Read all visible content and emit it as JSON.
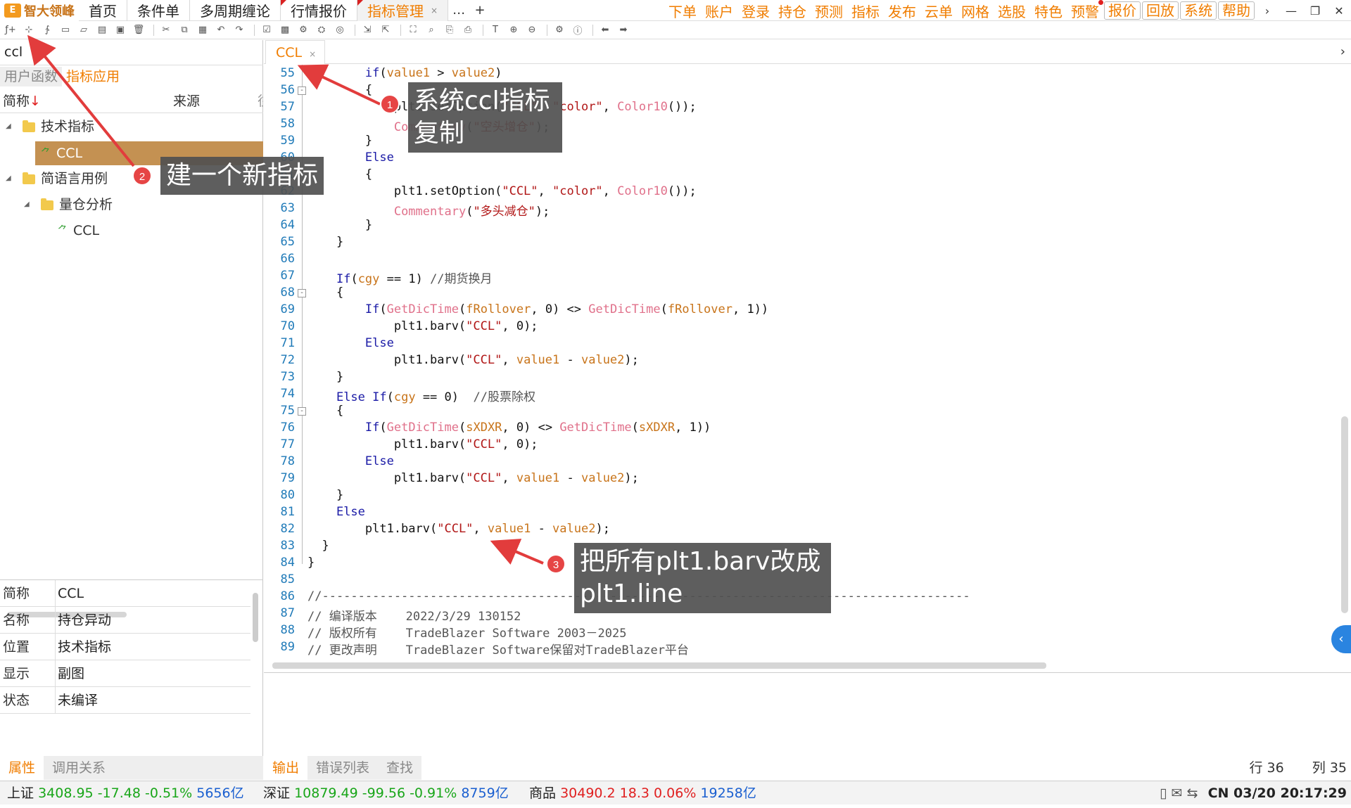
{
  "app": {
    "logo_text": "智大领峰",
    "logo_mark": "E"
  },
  "top_tabs": [
    {
      "label": "首页"
    },
    {
      "label": "条件单"
    },
    {
      "label": "多周期缠论"
    },
    {
      "label": "行情报价"
    },
    {
      "label": "指标管理",
      "close": "×"
    }
  ],
  "top_more": "…",
  "top_add": "+",
  "right_menu": [
    "下单",
    "账户",
    "登录",
    "持仓",
    "预测",
    "指标",
    "发布",
    "云单",
    "网格",
    "选股",
    "特色",
    "预警"
  ],
  "right_boxed": [
    "报价",
    "回放",
    "系统",
    "帮助"
  ],
  "window": {
    "chevron": "›",
    "minimize": "—",
    "restore": "❐",
    "close": "✕"
  },
  "search": {
    "value": "ccl"
  },
  "left_tabs": [
    {
      "label": "用户函数"
    },
    {
      "label": "指标应用"
    }
  ],
  "tree_header": {
    "name": "简称",
    "sort": "↓",
    "source": "来源",
    "extra": "往"
  },
  "tree": [
    {
      "label": "技术指标",
      "type": "folder",
      "expanded": true
    },
    {
      "label": "CCL",
      "type": "indicator",
      "selected": true
    },
    {
      "label": "简语言用例",
      "type": "folder",
      "expanded": true
    },
    {
      "label": "量仓分析",
      "type": "folder",
      "expanded": true
    },
    {
      "label": "CCL",
      "type": "indicator"
    }
  ],
  "properties": [
    {
      "key": "简称",
      "value": "CCL"
    },
    {
      "key": "名称",
      "value": "持仓异动"
    },
    {
      "key": "位置",
      "value": "技术指标"
    },
    {
      "key": "显示",
      "value": "副图"
    },
    {
      "key": "状态",
      "value": "未编译"
    }
  ],
  "left_bottom_tabs": [
    {
      "label": "属性"
    },
    {
      "label": "调用关系"
    }
  ],
  "editor": {
    "tab_label": "CCL",
    "tab_close": "×",
    "chevron": "›",
    "lines": [
      {
        "n": "55",
        "html": "        <span class='kw'>if</span>(<span class='var'>value1</span> &gt; <span class='var'>value2</span>)"
      },
      {
        "n": "56",
        "html": "        {",
        "fold": "-"
      },
      {
        "n": "57",
        "html": "            plt1.setOption(<span class='str'>\"CCL\"</span>, <span class='str'>\"color\"</span>, <span class='fn'>Color10</span>());"
      },
      {
        "n": "58",
        "html": "            <span class='fn'>Commentary</span>(<span class='str'>\"空头增仓\"</span>);"
      },
      {
        "n": "59",
        "html": "        }"
      },
      {
        "n": "60",
        "html": "        <span class='kw'>Else</span>"
      },
      {
        "n": "61",
        "html": "        {"
      },
      {
        "n": "62",
        "html": "            plt1.setOption(<span class='str'>\"CCL\"</span>, <span class='str'>\"color\"</span>, <span class='fn'>Color10</span>());"
      },
      {
        "n": "63",
        "html": "            <span class='fn'>Commentary</span>(<span class='str'>\"多头减仓\"</span>);"
      },
      {
        "n": "64",
        "html": "        }"
      },
      {
        "n": "65",
        "html": "    }"
      },
      {
        "n": "66",
        "html": ""
      },
      {
        "n": "67",
        "html": "    <span class='kw'>If</span>(<span class='var'>cgy</span> == 1) <span class='cm'>//期货换月</span>"
      },
      {
        "n": "68",
        "html": "    {",
        "fold": "-"
      },
      {
        "n": "69",
        "html": "        <span class='kw'>If</span>(<span class='fn'>GetDicTime</span>(<span class='var'>fRollover</span>, 0) &lt;&gt; <span class='fn'>GetDicTime</span>(<span class='var'>fRollover</span>, 1))"
      },
      {
        "n": "70",
        "html": "            plt1.barv(<span class='str'>\"CCL\"</span>, 0);"
      },
      {
        "n": "71",
        "html": "        <span class='kw'>Else</span>"
      },
      {
        "n": "72",
        "html": "            plt1.barv(<span class='str'>\"CCL\"</span>, <span class='var'>value1</span> - <span class='var'>value2</span>);"
      },
      {
        "n": "73",
        "html": "    }"
      },
      {
        "n": "74",
        "html": "    <span class='kw'>Else If</span>(<span class='var'>cgy</span> == 0)  <span class='cm'>//股票除权</span>"
      },
      {
        "n": "75",
        "html": "    {",
        "fold": "-"
      },
      {
        "n": "76",
        "html": "        <span class='kw'>If</span>(<span class='fn'>GetDicTime</span>(<span class='var'>sXDXR</span>, 0) &lt;&gt; <span class='fn'>GetDicTime</span>(<span class='var'>sXDXR</span>, 1))"
      },
      {
        "n": "77",
        "html": "            plt1.barv(<span class='str'>\"CCL\"</span>, 0);"
      },
      {
        "n": "78",
        "html": "        <span class='kw'>Else</span>"
      },
      {
        "n": "79",
        "html": "            plt1.barv(<span class='str'>\"CCL\"</span>, <span class='var'>value1</span> - <span class='var'>value2</span>);"
      },
      {
        "n": "80",
        "html": "    }"
      },
      {
        "n": "81",
        "html": "    <span class='kw'>Else</span>"
      },
      {
        "n": "82",
        "html": "        plt1.barv(<span class='str'>\"CCL\"</span>, <span class='var'>value1</span> - <span class='var'>value2</span>);"
      },
      {
        "n": "83",
        "html": "  }"
      },
      {
        "n": "84",
        "html": "}"
      },
      {
        "n": "85",
        "html": ""
      },
      {
        "n": "86",
        "html": "<span class='cm'>//------------------------------------------------------------------------------------------</span>"
      },
      {
        "n": "87",
        "html": "<span class='cm'>// 编译版本    2022/3/29 130152</span>"
      },
      {
        "n": "88",
        "html": "<span class='cm'>// 版权所有    TradeBlazer Software 2003－2025</span>"
      },
      {
        "n": "89",
        "html": "<span class='cm'>// 更改声明    TradeBlazer Software保留对TradeBlazer平台</span>"
      }
    ]
  },
  "output_tabs": [
    {
      "label": "输出"
    },
    {
      "label": "错误列表"
    },
    {
      "label": "查找"
    }
  ],
  "cursor": {
    "row": "行 36",
    "col": "列 35"
  },
  "status": {
    "sh": {
      "name": "上证",
      "price": "3408.95",
      "chg": "-17.48",
      "pct": "-0.51%",
      "vol": "5656亿"
    },
    "sz": {
      "name": "深证",
      "price": "10879.49",
      "chg": "-99.56",
      "pct": "-0.91%",
      "vol": "8759亿"
    },
    "cm": {
      "name": "商品",
      "price": "30490.2",
      "chg": "18.3",
      "pct": "0.06%",
      "vol": "19258亿"
    },
    "clock": "CN 03/20 20:17:29"
  },
  "annotations": [
    {
      "num": "1",
      "text": "系统ccl指标复制"
    },
    {
      "num": "2",
      "text": "建一个新指标"
    },
    {
      "num": "3",
      "text": "把所有plt1.barv改成plt1.line"
    }
  ],
  "colors": {
    "accent": "#f07d00",
    "up": "#e02020",
    "down": "#19a619",
    "volume": "#1a5fd0",
    "annotation_bg": "#505050",
    "badge": "#e64545"
  }
}
